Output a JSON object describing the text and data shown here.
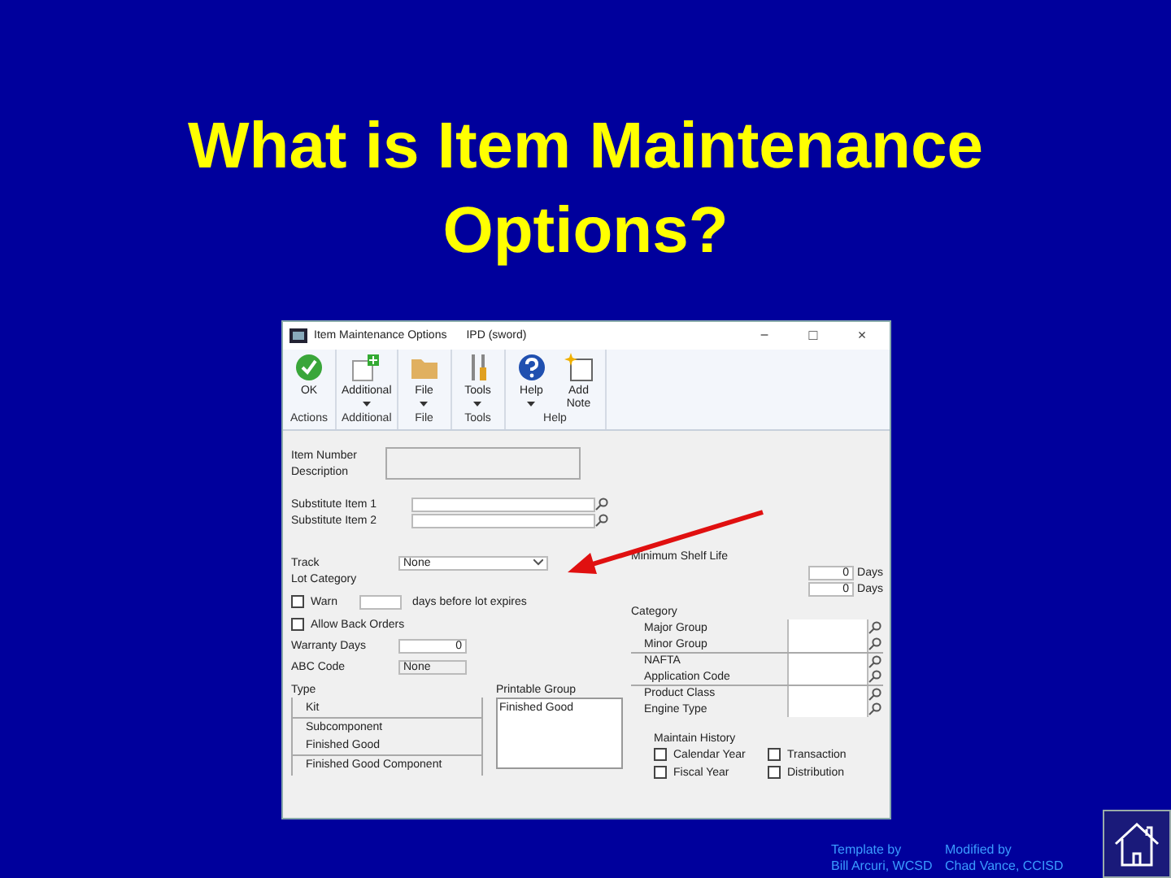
{
  "slide": {
    "title": "What is Item Maintenance Options?"
  },
  "window": {
    "title": "Item Maintenance Options",
    "subtitle": "IPD (sword)",
    "controls": [
      "−",
      "□",
      "×"
    ]
  },
  "ribbon": {
    "groups": [
      {
        "label": "Actions",
        "buttons": [
          {
            "label": "OK",
            "kind": "ok",
            "dropdown": false
          }
        ]
      },
      {
        "label": "Additional",
        "buttons": [
          {
            "label": "Additional",
            "kind": "additional",
            "dropdown": true
          }
        ]
      },
      {
        "label": "File",
        "buttons": [
          {
            "label": "File",
            "kind": "file",
            "dropdown": true
          }
        ]
      },
      {
        "label": "Tools",
        "buttons": [
          {
            "label": "Tools",
            "kind": "tools",
            "dropdown": true
          }
        ]
      },
      {
        "label": "Help",
        "buttons": [
          {
            "label": "Help",
            "kind": "help",
            "dropdown": true
          },
          {
            "label": "Add Note",
            "kind": "note",
            "dropdown": false
          }
        ]
      }
    ]
  },
  "form": {
    "item_labels": [
      "Item Number",
      "Description"
    ],
    "substitutes": [
      {
        "label": "Substitute Item 1"
      },
      {
        "label": "Substitute Item 2"
      }
    ],
    "track": {
      "label": "Track",
      "value": "None"
    },
    "lot_category": {
      "label": "Lot Category"
    },
    "warn": {
      "label": "Warn",
      "checked": false,
      "suffix": "days before lot expires"
    },
    "allow_back_orders": {
      "label": "Allow Back Orders",
      "checked": false
    },
    "warranty_days": {
      "label": "Warranty Days",
      "value": "0"
    },
    "abc_code": {
      "label": "ABC Code",
      "value": "None"
    },
    "item_type": {
      "label": "Type",
      "items": [
        "Kit",
        "Subcomponent",
        "Finished Good",
        "Finished Good Component"
      ]
    },
    "printable_group": {
      "label": "Printable Group",
      "items": [
        "Finished Good"
      ]
    },
    "shelf_life": {
      "label": "Minimum Shelf Life",
      "rows": [
        {
          "value": "0",
          "unit": "Days"
        },
        {
          "value": "0",
          "unit": "Days"
        }
      ]
    },
    "category": {
      "label": "Category",
      "items": [
        "Major Group",
        "Minor Group",
        "NAFTA",
        "Application Code",
        "Product Class",
        "Engine Type"
      ]
    },
    "history": {
      "label": "Maintain History",
      "options": [
        {
          "label": "Calendar Year",
          "checked": false
        },
        {
          "label": "Transaction",
          "checked": false
        },
        {
          "label": "Fiscal Year",
          "checked": false
        },
        {
          "label": "Distribution",
          "checked": false
        }
      ]
    }
  },
  "footer": {
    "template_label": "Template by",
    "template_author": "Bill Arcuri, WCSD",
    "modified_label": "Modified by",
    "modified_author": "Chad Vance, CCISD"
  }
}
